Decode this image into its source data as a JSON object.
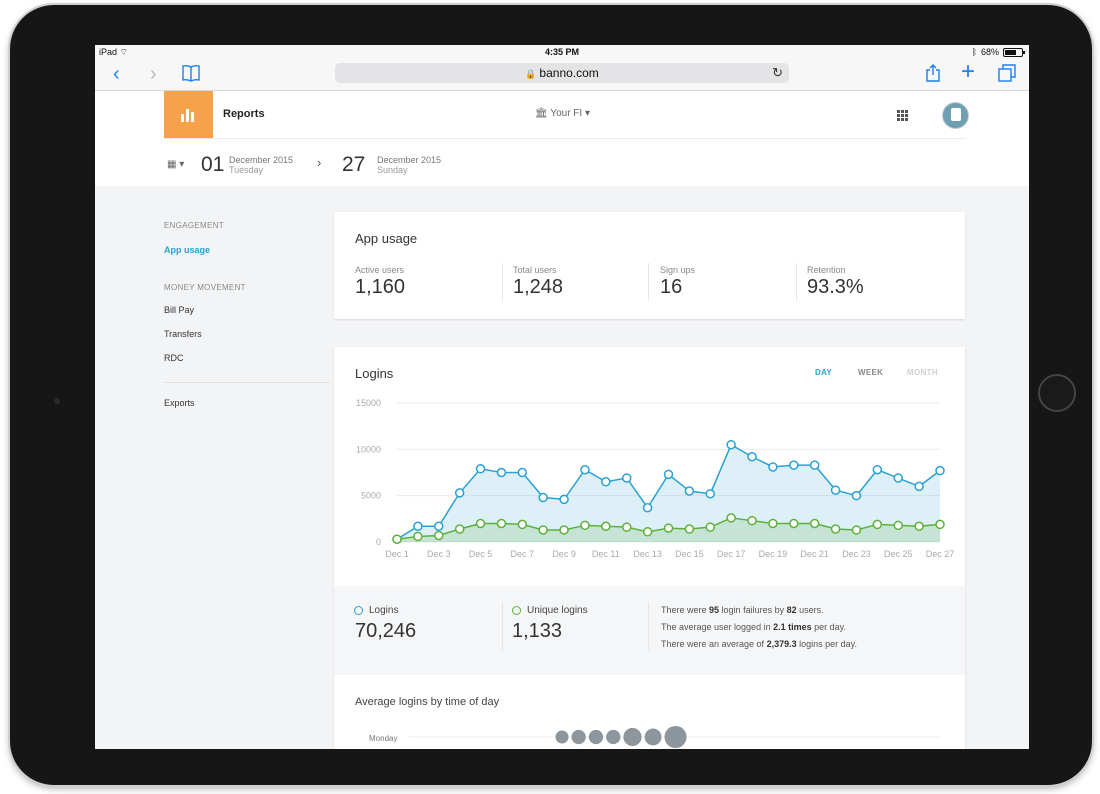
{
  "status": {
    "device": "iPad",
    "time": "4:35 PM",
    "battery": "68%",
    "battery_level": 0.68
  },
  "browser": {
    "url": "banno.com"
  },
  "header": {
    "app_title": "Reports",
    "fi_select": "Your FI",
    "start": {
      "day": "01",
      "month": "December 2015",
      "weekday": "Tuesday"
    },
    "end": {
      "day": "27",
      "month": "December 2015",
      "weekday": "Sunday"
    }
  },
  "sidebar": {
    "engagement_heading": "ENGAGEMENT",
    "app_usage": "App usage",
    "money_heading": "MONEY MOVEMENT",
    "bill_pay": "Bill Pay",
    "transfers": "Transfers",
    "rdc": "RDC",
    "exports": "Exports"
  },
  "app_usage": {
    "title": "App usage",
    "stats": [
      {
        "label": "Active users",
        "value": "1,160"
      },
      {
        "label": "Total users",
        "value": "1,248"
      },
      {
        "label": "Sign ups",
        "value": "16"
      },
      {
        "label": "Retention",
        "value": "93.3%"
      }
    ]
  },
  "logins": {
    "title": "Logins",
    "toggles": {
      "day": "DAY",
      "week": "WEEK",
      "month": "MONTH"
    },
    "summary": {
      "logins_label": "Logins",
      "logins_value": "70,246",
      "unique_label": "Unique logins",
      "unique_value": "1,133",
      "line1": {
        "a": "There were ",
        "b": "95",
        "c": " login failures by ",
        "d": "82",
        "e": " users."
      },
      "line2": {
        "a": "The average user logged in ",
        "b": "2.1 times",
        "c": " per day."
      },
      "line3": {
        "a": "There were an average of ",
        "b": "2,379.3",
        "c": " logins per day."
      }
    },
    "avg_title": "Average logins by time of day",
    "avg_day_label": "Monday"
  },
  "colors": {
    "accent": "#2aa0d4",
    "logins": "#2aa0d4",
    "unique": "#5db13a",
    "brand": "#f5a24a",
    "inactive": "#c9c9c9"
  },
  "chart_data": {
    "type": "line",
    "x": [
      "Dec 1",
      "Dec 2",
      "Dec 3",
      "Dec 4",
      "Dec 5",
      "Dec 6",
      "Dec 7",
      "Dec 8",
      "Dec 9",
      "Dec 10",
      "Dec 11",
      "Dec 12",
      "Dec 13",
      "Dec 14",
      "Dec 15",
      "Dec 16",
      "Dec 17",
      "Dec 18",
      "Dec 19",
      "Dec 20",
      "Dec 21",
      "Dec 22",
      "Dec 23",
      "Dec 24",
      "Dec 25",
      "Dec 26",
      "Dec 27"
    ],
    "x_tick_labels": [
      "Dec 1",
      "Dec 3",
      "Dec 5",
      "Dec 7",
      "Dec 9",
      "Dec 11",
      "Dec 13",
      "Dec 15",
      "Dec 17",
      "Dec 19",
      "Dec 21",
      "Dec 23",
      "Dec 25",
      "Dec 27"
    ],
    "y_ticks": [
      "15000",
      "10000",
      "5000",
      "0"
    ],
    "ylim": [
      0,
      15000
    ],
    "grid": true,
    "series": [
      {
        "name": "Logins",
        "values": [
          300,
          1700,
          1700,
          5300,
          7900,
          7500,
          7500,
          4800,
          4600,
          7800,
          6500,
          6900,
          3700,
          7300,
          5500,
          5200,
          10500,
          9200,
          8100,
          8300,
          8300,
          5600,
          5000,
          7800,
          6900,
          6000,
          7700
        ]
      },
      {
        "name": "Unique logins",
        "values": [
          300,
          600,
          700,
          1400,
          2000,
          2000,
          1900,
          1300,
          1300,
          1800,
          1700,
          1600,
          1100,
          1500,
          1400,
          1600,
          2600,
          2300,
          2000,
          2000,
          2000,
          1400,
          1300,
          1900,
          1800,
          1700,
          1900
        ]
      }
    ]
  },
  "time_of_day": {
    "day": "Monday",
    "bubble_sizes": [
      1,
      1.1,
      1.1,
      1.1,
      1.4,
      1.3,
      1.7
    ]
  }
}
